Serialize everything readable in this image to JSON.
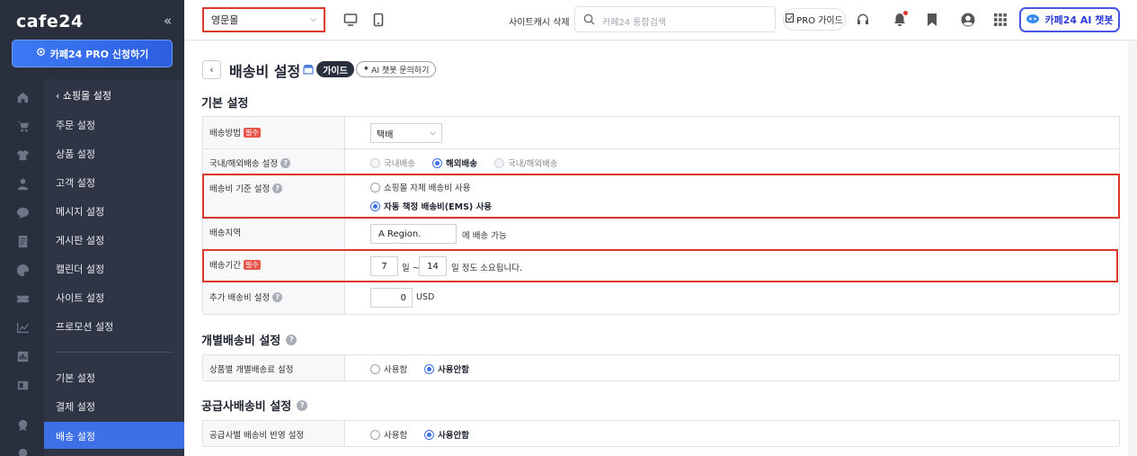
{
  "brand": {
    "logo": "cafe24",
    "collapse": "«",
    "pro_button": "카페24 PRO 신청하기"
  },
  "sidebar": {
    "back_label": "쇼핑몰 설정",
    "items": [
      "주문 설정",
      "상품 설정",
      "고객 설정",
      "메시지 설정",
      "게시판 설정",
      "캘린더 설정",
      "사이트 설정",
      "프로모션 설정"
    ],
    "items2": [
      "기본 설정",
      "결제 설정",
      "배송 설정"
    ],
    "active": "배송 설정"
  },
  "topbar": {
    "mall_select": "영문몰",
    "cache_delete": "사이트캐시 삭제",
    "search_placeholder": "카페24 통합검색",
    "pro_guide": "PRO 가이드",
    "ai_chat": "카페24 AI 챗봇"
  },
  "page": {
    "title": "배송비 설정",
    "guide_badge": "가이드",
    "ai_chip": "AI 챗봇 문의하기"
  },
  "sections": {
    "basic": "기본 설정",
    "individual": "개별배송비 설정",
    "supplier": "공급사배송비 설정"
  },
  "basic_rows": {
    "method_label": "배송방법",
    "required": "필수",
    "method_value": "택배",
    "domestic_label": "국내/해외배송 설정",
    "domestic_opts": [
      "국내배송",
      "해외배송",
      "국내/해외배송"
    ],
    "fee_basis_label": "배송비 기준 설정",
    "fee_basis_opts": [
      "쇼핑몰 자체 배송비 사용",
      "자동 책정 배송비(EMS) 사용"
    ],
    "region_label": "배송지역",
    "region_value": "A Region.",
    "region_suffix": "에 배송 가능",
    "period_label": "배송기간",
    "period_from": "7",
    "period_mid": "일 ~",
    "period_to": "14",
    "period_suffix": "일 정도 소요됩니다.",
    "extra_label": "추가 배송비 설정",
    "extra_value": "0",
    "extra_unit": "USD"
  },
  "individual_row": {
    "label": "상품별 개별배송료 설정",
    "opts": [
      "사용함",
      "사용안함"
    ]
  },
  "supplier_row": {
    "label": "공급사별 배송비 반영 설정",
    "opts": [
      "사용함",
      "사용안함"
    ]
  },
  "colors": {
    "accent": "#3b6fe5",
    "highlight": "#d9382a",
    "sidebar": "#2a2f3e"
  }
}
